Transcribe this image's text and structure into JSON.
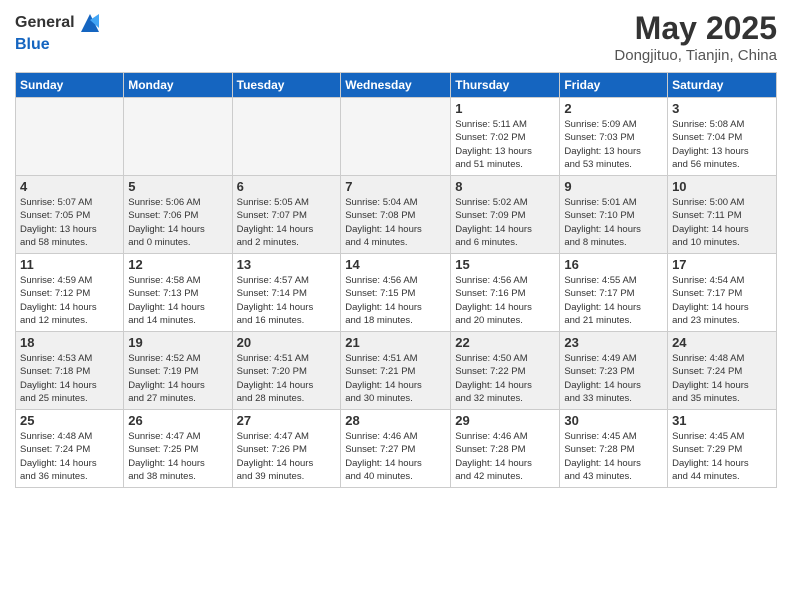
{
  "header": {
    "logo_general": "General",
    "logo_blue": "Blue",
    "title": "May 2025",
    "subtitle": "Dongjituo, Tianjin, China"
  },
  "days_of_week": [
    "Sunday",
    "Monday",
    "Tuesday",
    "Wednesday",
    "Thursday",
    "Friday",
    "Saturday"
  ],
  "weeks": [
    [
      {
        "day": "",
        "info": ""
      },
      {
        "day": "",
        "info": ""
      },
      {
        "day": "",
        "info": ""
      },
      {
        "day": "",
        "info": ""
      },
      {
        "day": "1",
        "info": "Sunrise: 5:11 AM\nSunset: 7:02 PM\nDaylight: 13 hours\nand 51 minutes."
      },
      {
        "day": "2",
        "info": "Sunrise: 5:09 AM\nSunset: 7:03 PM\nDaylight: 13 hours\nand 53 minutes."
      },
      {
        "day": "3",
        "info": "Sunrise: 5:08 AM\nSunset: 7:04 PM\nDaylight: 13 hours\nand 56 minutes."
      }
    ],
    [
      {
        "day": "4",
        "info": "Sunrise: 5:07 AM\nSunset: 7:05 PM\nDaylight: 13 hours\nand 58 minutes."
      },
      {
        "day": "5",
        "info": "Sunrise: 5:06 AM\nSunset: 7:06 PM\nDaylight: 14 hours\nand 0 minutes."
      },
      {
        "day": "6",
        "info": "Sunrise: 5:05 AM\nSunset: 7:07 PM\nDaylight: 14 hours\nand 2 minutes."
      },
      {
        "day": "7",
        "info": "Sunrise: 5:04 AM\nSunset: 7:08 PM\nDaylight: 14 hours\nand 4 minutes."
      },
      {
        "day": "8",
        "info": "Sunrise: 5:02 AM\nSunset: 7:09 PM\nDaylight: 14 hours\nand 6 minutes."
      },
      {
        "day": "9",
        "info": "Sunrise: 5:01 AM\nSunset: 7:10 PM\nDaylight: 14 hours\nand 8 minutes."
      },
      {
        "day": "10",
        "info": "Sunrise: 5:00 AM\nSunset: 7:11 PM\nDaylight: 14 hours\nand 10 minutes."
      }
    ],
    [
      {
        "day": "11",
        "info": "Sunrise: 4:59 AM\nSunset: 7:12 PM\nDaylight: 14 hours\nand 12 minutes."
      },
      {
        "day": "12",
        "info": "Sunrise: 4:58 AM\nSunset: 7:13 PM\nDaylight: 14 hours\nand 14 minutes."
      },
      {
        "day": "13",
        "info": "Sunrise: 4:57 AM\nSunset: 7:14 PM\nDaylight: 14 hours\nand 16 minutes."
      },
      {
        "day": "14",
        "info": "Sunrise: 4:56 AM\nSunset: 7:15 PM\nDaylight: 14 hours\nand 18 minutes."
      },
      {
        "day": "15",
        "info": "Sunrise: 4:56 AM\nSunset: 7:16 PM\nDaylight: 14 hours\nand 20 minutes."
      },
      {
        "day": "16",
        "info": "Sunrise: 4:55 AM\nSunset: 7:17 PM\nDaylight: 14 hours\nand 21 minutes."
      },
      {
        "day": "17",
        "info": "Sunrise: 4:54 AM\nSunset: 7:17 PM\nDaylight: 14 hours\nand 23 minutes."
      }
    ],
    [
      {
        "day": "18",
        "info": "Sunrise: 4:53 AM\nSunset: 7:18 PM\nDaylight: 14 hours\nand 25 minutes."
      },
      {
        "day": "19",
        "info": "Sunrise: 4:52 AM\nSunset: 7:19 PM\nDaylight: 14 hours\nand 27 minutes."
      },
      {
        "day": "20",
        "info": "Sunrise: 4:51 AM\nSunset: 7:20 PM\nDaylight: 14 hours\nand 28 minutes."
      },
      {
        "day": "21",
        "info": "Sunrise: 4:51 AM\nSunset: 7:21 PM\nDaylight: 14 hours\nand 30 minutes."
      },
      {
        "day": "22",
        "info": "Sunrise: 4:50 AM\nSunset: 7:22 PM\nDaylight: 14 hours\nand 32 minutes."
      },
      {
        "day": "23",
        "info": "Sunrise: 4:49 AM\nSunset: 7:23 PM\nDaylight: 14 hours\nand 33 minutes."
      },
      {
        "day": "24",
        "info": "Sunrise: 4:48 AM\nSunset: 7:24 PM\nDaylight: 14 hours\nand 35 minutes."
      }
    ],
    [
      {
        "day": "25",
        "info": "Sunrise: 4:48 AM\nSunset: 7:24 PM\nDaylight: 14 hours\nand 36 minutes."
      },
      {
        "day": "26",
        "info": "Sunrise: 4:47 AM\nSunset: 7:25 PM\nDaylight: 14 hours\nand 38 minutes."
      },
      {
        "day": "27",
        "info": "Sunrise: 4:47 AM\nSunset: 7:26 PM\nDaylight: 14 hours\nand 39 minutes."
      },
      {
        "day": "28",
        "info": "Sunrise: 4:46 AM\nSunset: 7:27 PM\nDaylight: 14 hours\nand 40 minutes."
      },
      {
        "day": "29",
        "info": "Sunrise: 4:46 AM\nSunset: 7:28 PM\nDaylight: 14 hours\nand 42 minutes."
      },
      {
        "day": "30",
        "info": "Sunrise: 4:45 AM\nSunset: 7:28 PM\nDaylight: 14 hours\nand 43 minutes."
      },
      {
        "day": "31",
        "info": "Sunrise: 4:45 AM\nSunset: 7:29 PM\nDaylight: 14 hours\nand 44 minutes."
      }
    ]
  ]
}
